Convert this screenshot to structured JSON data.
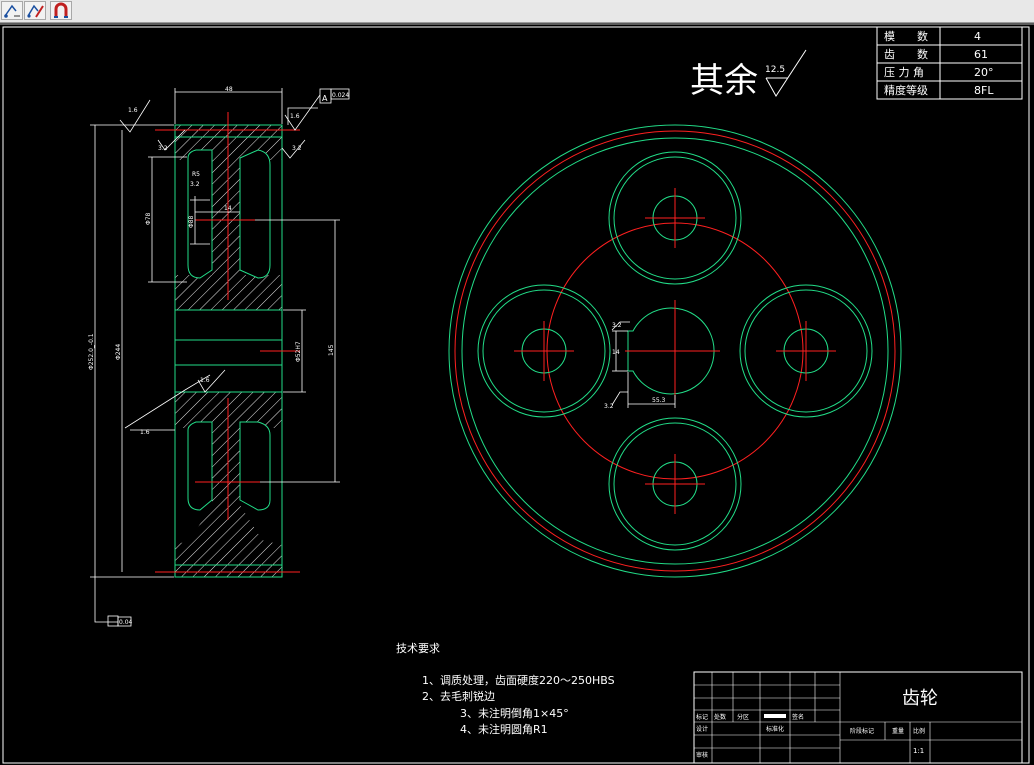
{
  "toolbar": {
    "tools": [
      {
        "icon": "dimension-icon"
      },
      {
        "icon": "edit-dimension-icon"
      },
      {
        "icon": "magnet-snap-icon"
      }
    ]
  },
  "drawing": {
    "roughness": {
      "label": "其余",
      "value": "12.5"
    },
    "param_table": {
      "rows": [
        {
          "label": "模　　数",
          "value": "4"
        },
        {
          "label": "齿　　数",
          "value": "61"
        },
        {
          "label": "压 力 角",
          "value": "20°"
        },
        {
          "label": "精度等级",
          "value": "8FL"
        }
      ]
    },
    "dims": {
      "width": "48",
      "flat_top": "0.024",
      "flat_bottom": "0.04",
      "flat_label": "A",
      "outer_dia": "Φ252.0_-0.1",
      "pitch_dia": "Φ244",
      "hub_dia": "Φ78",
      "bore": "Φ52H7",
      "ring_dia": "145",
      "rough1": "1.6",
      "rough2": "1.6",
      "rough3": "1.6",
      "rough4": "3.2",
      "rough5": "3.2",
      "rough6": "3.2",
      "r_label": "R5",
      "hub_w": "14",
      "web_label": "Φ88",
      "keyway_w": "14",
      "keyway_d": "55.3",
      "keyway_r": "3.2",
      "keyway_rough": "3.2"
    },
    "tech_req": {
      "title": "技术要求",
      "items": [
        "1、调质处理，齿面硬度220～250HBS",
        "2、去毛刺锐边",
        "3、未注明倒角1×45°",
        "4、未注明圆角R1"
      ]
    },
    "title_block": {
      "part_name": "齿轮",
      "labels": [
        "标记",
        "处数",
        "分区",
        "更改文件号",
        "签名",
        "设计",
        "标准化",
        "审核",
        "阶段标记",
        "重量",
        "比例"
      ],
      "scale": "1:1"
    }
  }
}
